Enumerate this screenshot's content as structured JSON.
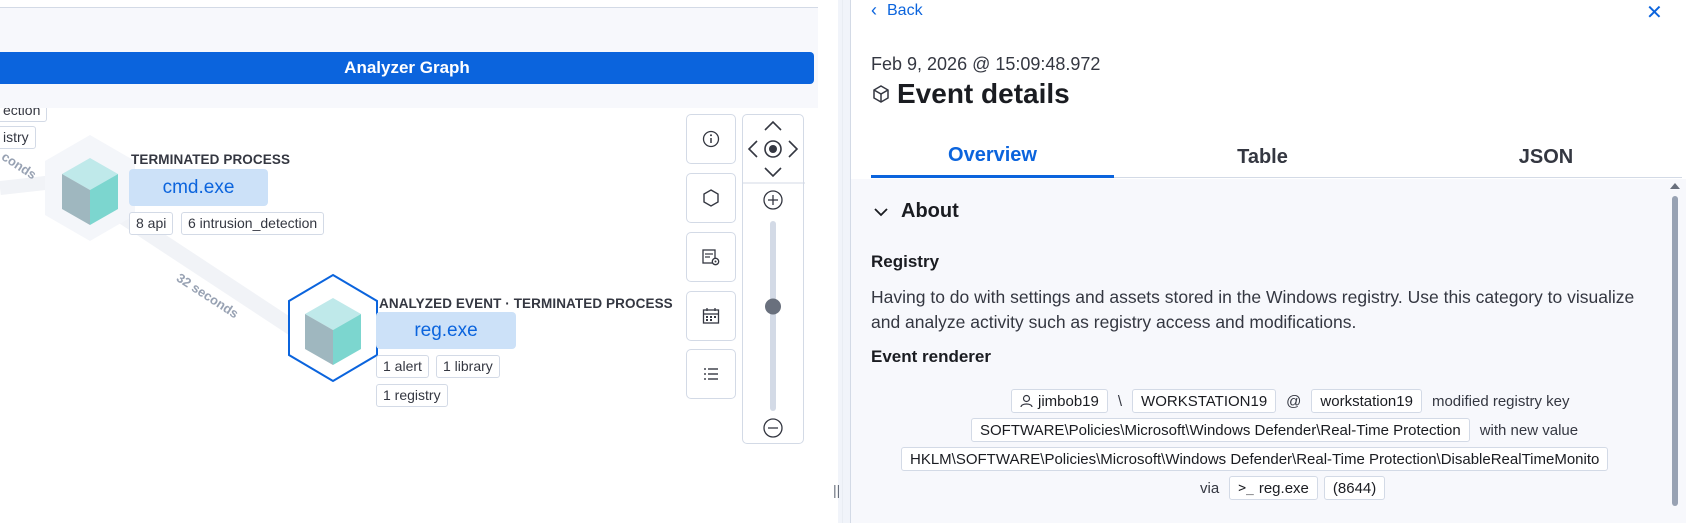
{
  "graph": {
    "title": "Analyzer Graph",
    "partial_labels": [
      "ection",
      "istry"
    ],
    "edge_label_partial": "conds",
    "edge_label": "32 seconds",
    "nodes": [
      {
        "type": "TERMINATED PROCESS",
        "name": "cmd.exe",
        "pills": [
          "8 api",
          "6 intrusion_detection"
        ]
      },
      {
        "type": "ANALYZED EVENT · TERMINATED PROCESS",
        "name": "reg.exe",
        "pills": [
          "1 alert",
          "1 library",
          "1 registry"
        ]
      }
    ],
    "controls": {
      "info": "info-icon",
      "nodes": "hexagon-icon",
      "settings": "gear-table-icon",
      "calendar": "calendar-icon",
      "list": "list-icon",
      "pan": "pan-icon",
      "zoom_in": "zoom-in-icon",
      "zoom_out": "zoom-out-icon"
    },
    "zoom_level": 0.55
  },
  "flyout": {
    "back_label": "Back",
    "timestamp": "Feb 9, 2026 @ 15:09:48.972",
    "title": "Event details",
    "tabs": [
      {
        "label": "Overview",
        "active": true
      },
      {
        "label": "Table",
        "active": false
      },
      {
        "label": "JSON",
        "active": false
      }
    ],
    "section": "About",
    "category_heading": "Registry",
    "category_description": "Having to do with settings and assets stored in the Windows registry. Use this category to visualize and analyze activity such as registry access and modifications.",
    "renderer_heading": "Event renderer",
    "renderer": {
      "user": "jimbob19",
      "sep": "\\",
      "domain": "WORKSTATION19",
      "at": "@",
      "host": "workstation19",
      "action": "modified registry key",
      "key": "SOFTWARE\\Policies\\Microsoft\\Windows Defender\\Real-Time Protection",
      "with_new_value": "with new value",
      "value": "HKLM\\SOFTWARE\\Policies\\Microsoft\\Windows Defender\\Real-Time Protection\\DisableRealTimeMonito",
      "via": "via",
      "process": "reg.exe",
      "pid": "(8644)"
    }
  },
  "colors": {
    "accent": "#0b64dd",
    "node_label_bg": "#cce1f8",
    "cube_top": "#bfe9ea",
    "cube_left": "#9fb7bf",
    "cube_right": "#7cd6cf"
  }
}
